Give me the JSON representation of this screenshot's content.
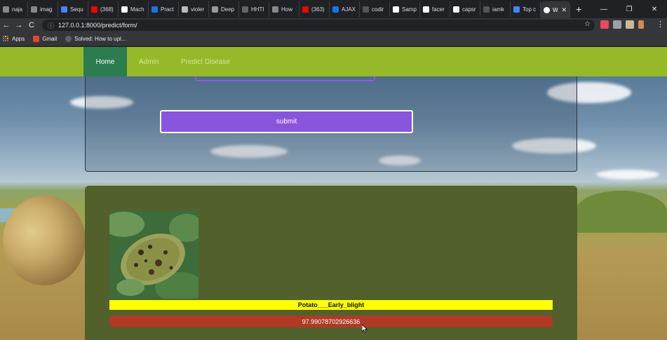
{
  "browser": {
    "tabs": [
      {
        "label": "naja",
        "color": "#888888"
      },
      {
        "label": "imag",
        "color": "#888888"
      },
      {
        "label": "Sequ",
        "color": "#4285f4"
      },
      {
        "label": "(368)",
        "color": "#ff0000"
      },
      {
        "label": "Mach",
        "color": "#ffffff"
      },
      {
        "label": "Pract",
        "color": "#1a73e8"
      },
      {
        "label": "violer",
        "color": "#bbbbbb"
      },
      {
        "label": "Deep",
        "color": "#999999"
      },
      {
        "label": "HHTI",
        "color": "#666666"
      },
      {
        "label": "How",
        "color": "#888888"
      },
      {
        "label": "(363)",
        "color": "#ff0000"
      },
      {
        "label": "AJAX",
        "color": "#1a73e8"
      },
      {
        "label": "codir",
        "color": "#555555"
      },
      {
        "label": "Samp",
        "color": "#ffffff"
      },
      {
        "label": "facer",
        "color": "#ffffff"
      },
      {
        "label": "capsr",
        "color": "#ffffff"
      },
      {
        "label": "iamk",
        "color": "#555555"
      },
      {
        "label": "Top c",
        "color": "#4285f4"
      }
    ],
    "active_tab": {
      "label": "W",
      "close": "✕"
    },
    "new_tab": "+",
    "window_controls": {
      "minimize": "—",
      "restore": "❐",
      "close": "✕"
    },
    "nav": {
      "back": "←",
      "forward": "→",
      "reload": "C"
    },
    "url": "127.0.0.1:8000/predict/form/",
    "info_icon": "ⓘ",
    "star_icon": "☆",
    "menu_icon": "⋮",
    "bookmarks": [
      {
        "label": "Apps",
        "icon": "apps-grid-icon"
      },
      {
        "label": "Gmail",
        "icon": "gmail-icon"
      },
      {
        "label": "Solved: How to upl...",
        "icon": "github-icon"
      }
    ]
  },
  "site": {
    "nav": {
      "home": "Home",
      "admin": "Admin",
      "predict": "Predict Disease"
    },
    "form": {
      "submit_label": "submit"
    },
    "result": {
      "disease": "Potato___Early_blight",
      "confidence": "97.99078702926636"
    }
  },
  "colors": {
    "navbar": "#95b929",
    "nav_active": "#2b7d4f",
    "submit": "#8a55dd",
    "result_panel": "#52602c",
    "disease_label_bg": "#ffff00",
    "confidence_bg": "#b03a26"
  }
}
